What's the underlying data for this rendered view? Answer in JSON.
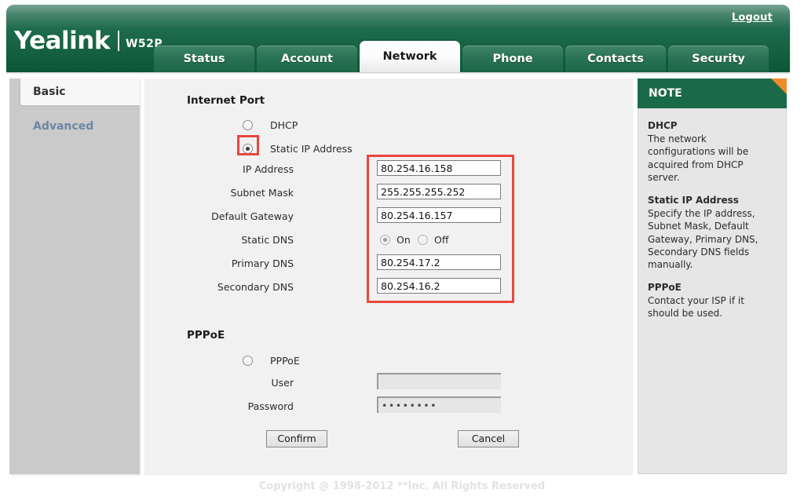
{
  "header": {
    "brand": "Yealink",
    "model": "W52P",
    "logout_label": "Logout"
  },
  "tabs": [
    {
      "label": "Status",
      "active": false
    },
    {
      "label": "Account",
      "active": false
    },
    {
      "label": "Network",
      "active": true
    },
    {
      "label": "Phone",
      "active": false
    },
    {
      "label": "Contacts",
      "active": false
    },
    {
      "label": "Security",
      "active": false
    }
  ],
  "sidebar": {
    "items": [
      {
        "label": "Basic",
        "active": true
      },
      {
        "label": "Advanced",
        "active": false
      }
    ]
  },
  "main": {
    "internet_port": {
      "title": "Internet Port",
      "dhcp_label": "DHCP",
      "static_label": "Static IP Address",
      "fields": {
        "ip_address_label": "IP Address",
        "ip_address_value": "80.254.16.158",
        "subnet_mask_label": "Subnet Mask",
        "subnet_mask_value": "255.255.255.252",
        "default_gateway_label": "Default Gateway",
        "default_gateway_value": "80.254.16.157",
        "static_dns_label": "Static DNS",
        "static_dns_on_label": "On",
        "static_dns_off_label": "Off",
        "primary_dns_label": "Primary DNS",
        "primary_dns_value": "80.254.17.2",
        "secondary_dns_label": "Secondary DNS",
        "secondary_dns_value": "80.254.16.2"
      }
    },
    "pppoe": {
      "title": "PPPoE",
      "radio_label": "PPPoE",
      "user_label": "User",
      "user_value": "",
      "password_label": "Password",
      "password_value": "••••••••"
    },
    "buttons": {
      "confirm_label": "Confirm",
      "cancel_label": "Cancel"
    }
  },
  "note": {
    "header": "NOTE",
    "entries": [
      {
        "title": "DHCP",
        "text": "The network configurations will be acquired from DHCP server."
      },
      {
        "title": "Static IP Address",
        "text": "Specify the IP address, Subnet Mask, Default Gateway, Primary DNS, Secondary DNS fields manually."
      },
      {
        "title": "PPPoE",
        "text": "Contact your ISP if it should be used."
      }
    ]
  },
  "footer": {
    "copyright": "Copyright @ 1998-2012 **Inc. All Rights Reserved"
  },
  "colors": {
    "brand_green": "#1a6a4a",
    "accent_orange": "#ef8b28",
    "annotation_red": "#e8473f",
    "sidebar_gray": "#cacaca",
    "content_gray": "#f1f1f1"
  }
}
